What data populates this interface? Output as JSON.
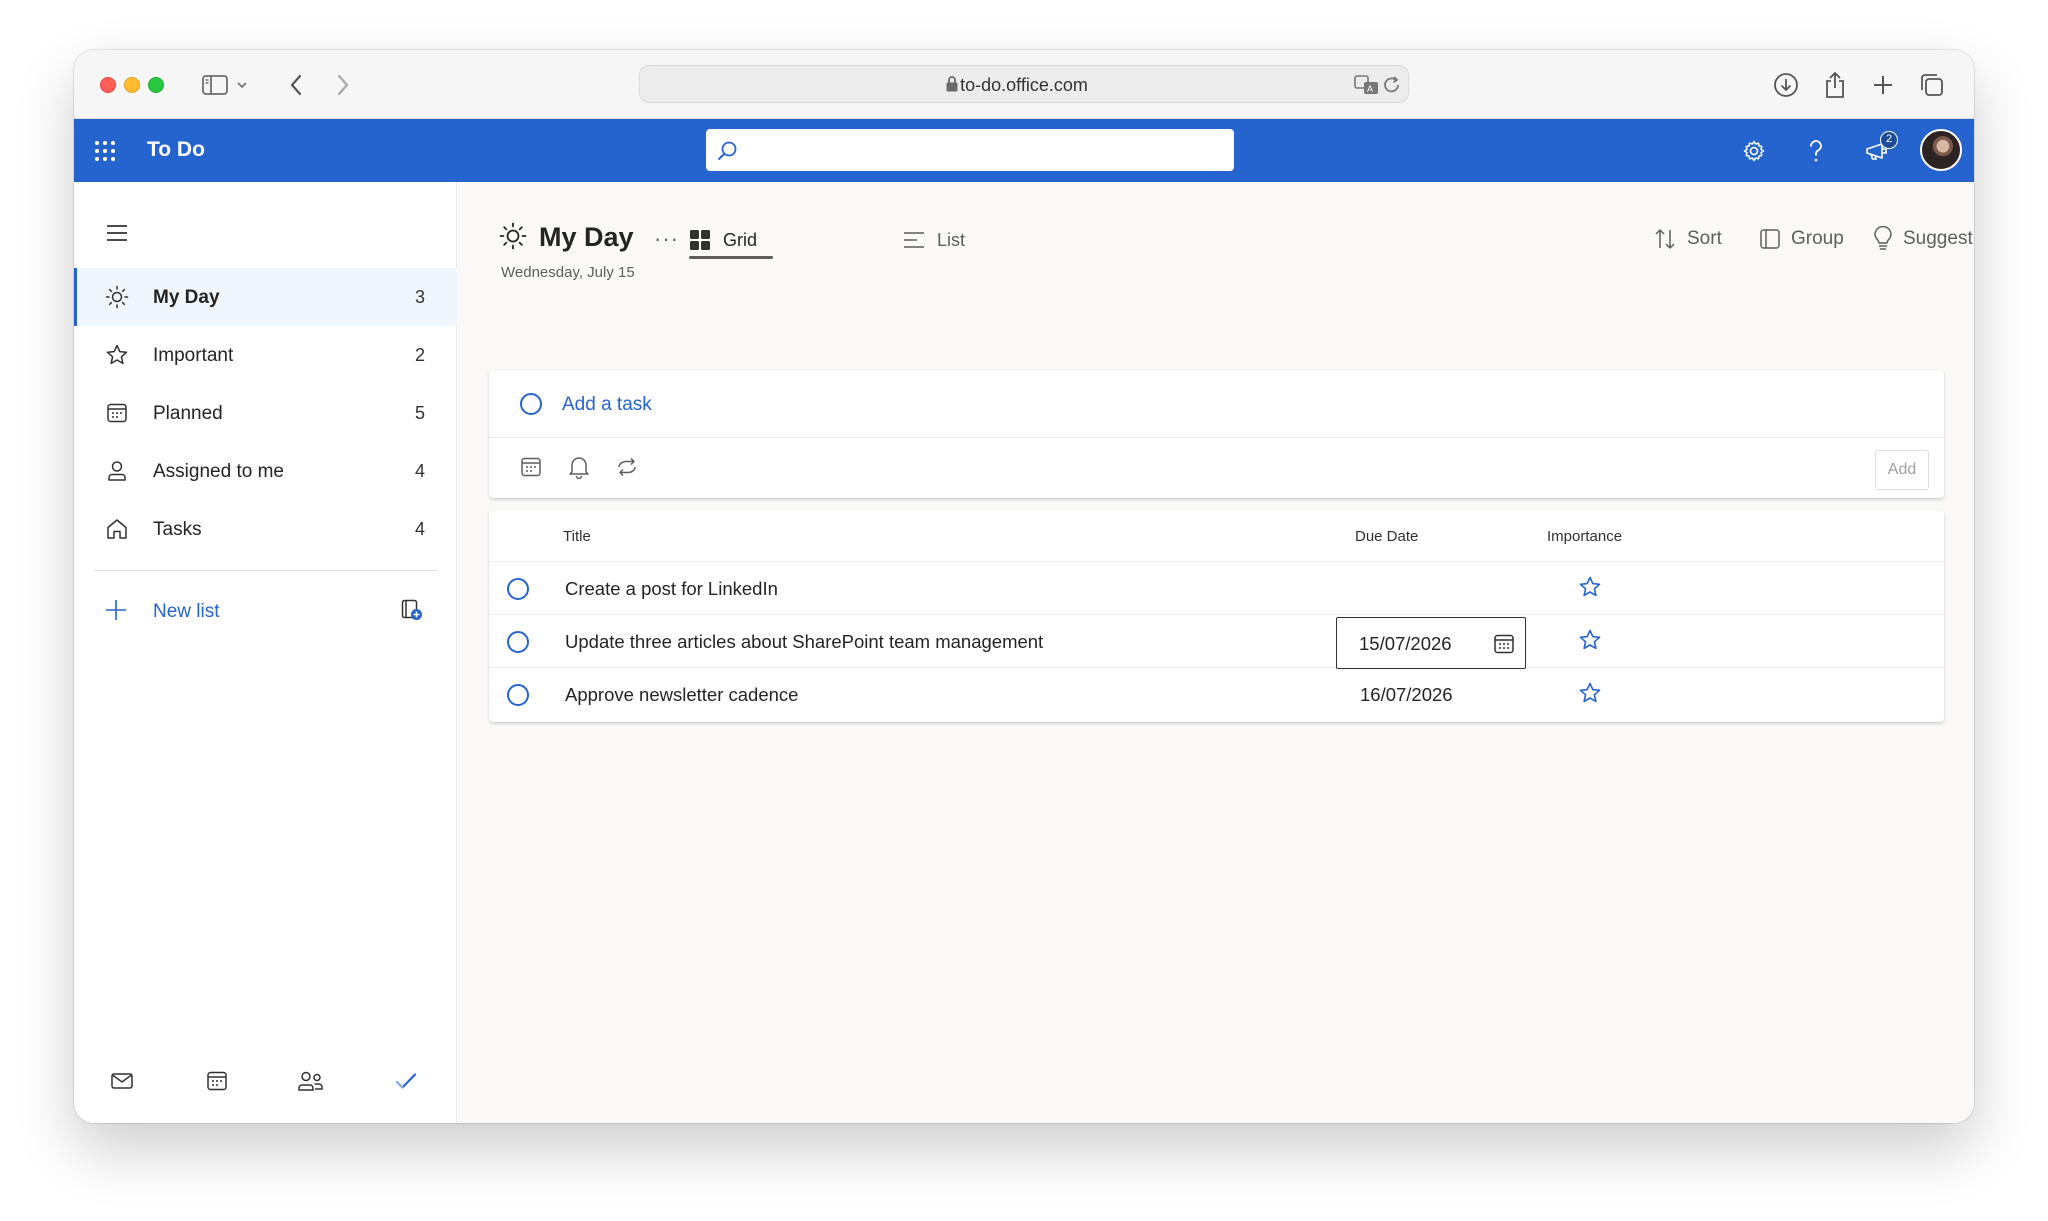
{
  "browser": {
    "url": "to-do.office.com"
  },
  "app": {
    "title": "To Do",
    "search_placeholder": "",
    "notification_count": "2",
    "accent_color": "#2564cf"
  },
  "sidebar": {
    "items": [
      {
        "label": "My Day",
        "count": "3",
        "icon": "sun-icon",
        "active": true
      },
      {
        "label": "Important",
        "count": "2",
        "icon": "star-icon",
        "active": false
      },
      {
        "label": "Planned",
        "count": "5",
        "icon": "calendar-icon",
        "active": false
      },
      {
        "label": "Assigned to me",
        "count": "4",
        "icon": "person-icon",
        "active": false
      },
      {
        "label": "Tasks",
        "count": "4",
        "icon": "home-icon",
        "active": false
      }
    ],
    "new_list_label": "New list",
    "bottom_icons": [
      "mail-icon",
      "calendar-icon",
      "people-icon",
      "todo-check-icon"
    ]
  },
  "main": {
    "title": "My Day",
    "more": "···",
    "date": "Wednesday, July 15",
    "views": [
      {
        "label": "Grid",
        "selected": true
      },
      {
        "label": "List",
        "selected": false
      }
    ],
    "toolbar": {
      "sort": "Sort",
      "group": "Group",
      "suggestions": "Suggestions"
    },
    "add_task": {
      "label": "Add a task",
      "add_button": "Add",
      "option_icons": [
        "due-date-icon",
        "reminder-bell-icon",
        "repeat-icon"
      ]
    },
    "grid": {
      "columns": [
        "Title",
        "Due Date",
        "Importance"
      ],
      "rows": [
        {
          "title": "Create a post for LinkedIn",
          "due": "",
          "important": false,
          "editing_date": false
        },
        {
          "title": "Update three articles about SharePoint team management",
          "due": "15/07/2026",
          "important": false,
          "editing_date": true
        },
        {
          "title": "Approve newsletter cadence",
          "due": "16/07/2026",
          "important": false,
          "editing_date": false
        }
      ]
    }
  }
}
